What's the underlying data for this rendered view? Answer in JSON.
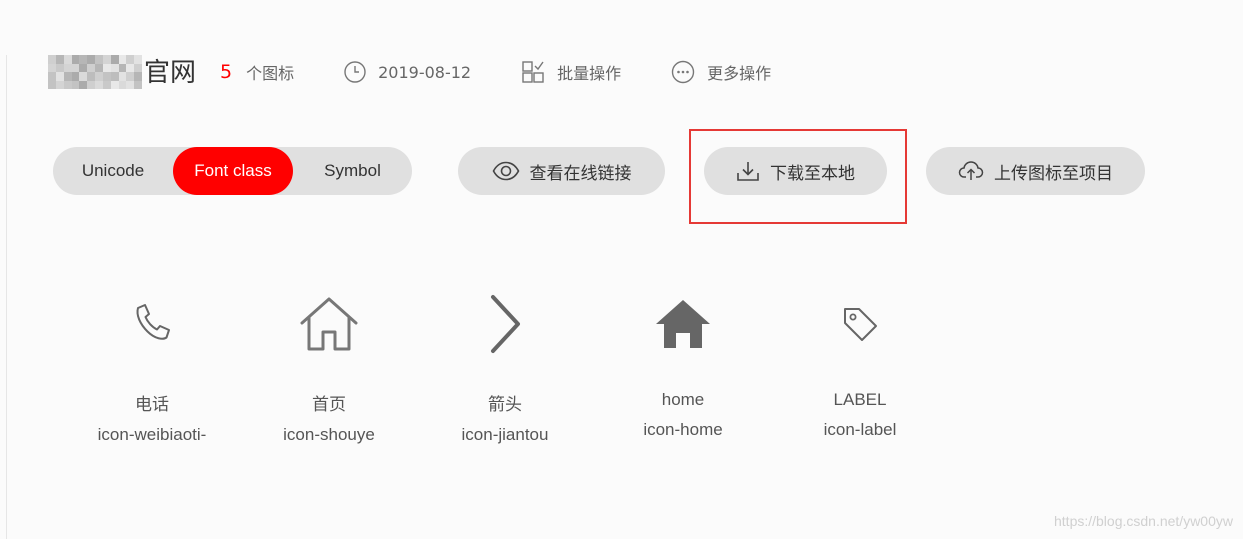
{
  "header": {
    "title_suffix": "官网",
    "icon_count": "5",
    "count_unit": "个图标",
    "date": "2019-08-12",
    "batch_label": "批量操作",
    "more_label": "更多操作",
    "icons": {
      "date": "clock-icon",
      "batch": "batch-grid-icon",
      "more": "more-dots-icon"
    }
  },
  "toolbar": {
    "mode_tabs": [
      {
        "label": "Unicode",
        "selected": false
      },
      {
        "label": "Font class",
        "selected": true
      },
      {
        "label": "Symbol",
        "selected": false
      }
    ],
    "view_link_label": "查看在线链接",
    "download_label": "下载至本地",
    "upload_label": "上传图标至项目",
    "icons": {
      "view_link": "eye-icon",
      "download": "download-icon",
      "upload": "cloud-upload-icon"
    }
  },
  "icon_list": [
    {
      "name": "电话",
      "class_name": "icon-weibiaoti-",
      "glyph": "phone-icon"
    },
    {
      "name": "首页",
      "class_name": "icon-shouye",
      "glyph": "house-outline-icon"
    },
    {
      "name": "箭头",
      "class_name": "icon-jiantou",
      "glyph": "chevron-right-icon"
    },
    {
      "name": "home",
      "class_name": "icon-home",
      "glyph": "house-filled-icon"
    },
    {
      "name": "LABEL",
      "class_name": "icon-label",
      "glyph": "tag-icon"
    }
  ],
  "watermark": "https://blog.csdn.net/yw00yw",
  "colors": {
    "accent": "#ff0000",
    "pill_bg": "#e0e0e0",
    "highlight_border": "#e53935",
    "icon_gray": "#666666"
  }
}
